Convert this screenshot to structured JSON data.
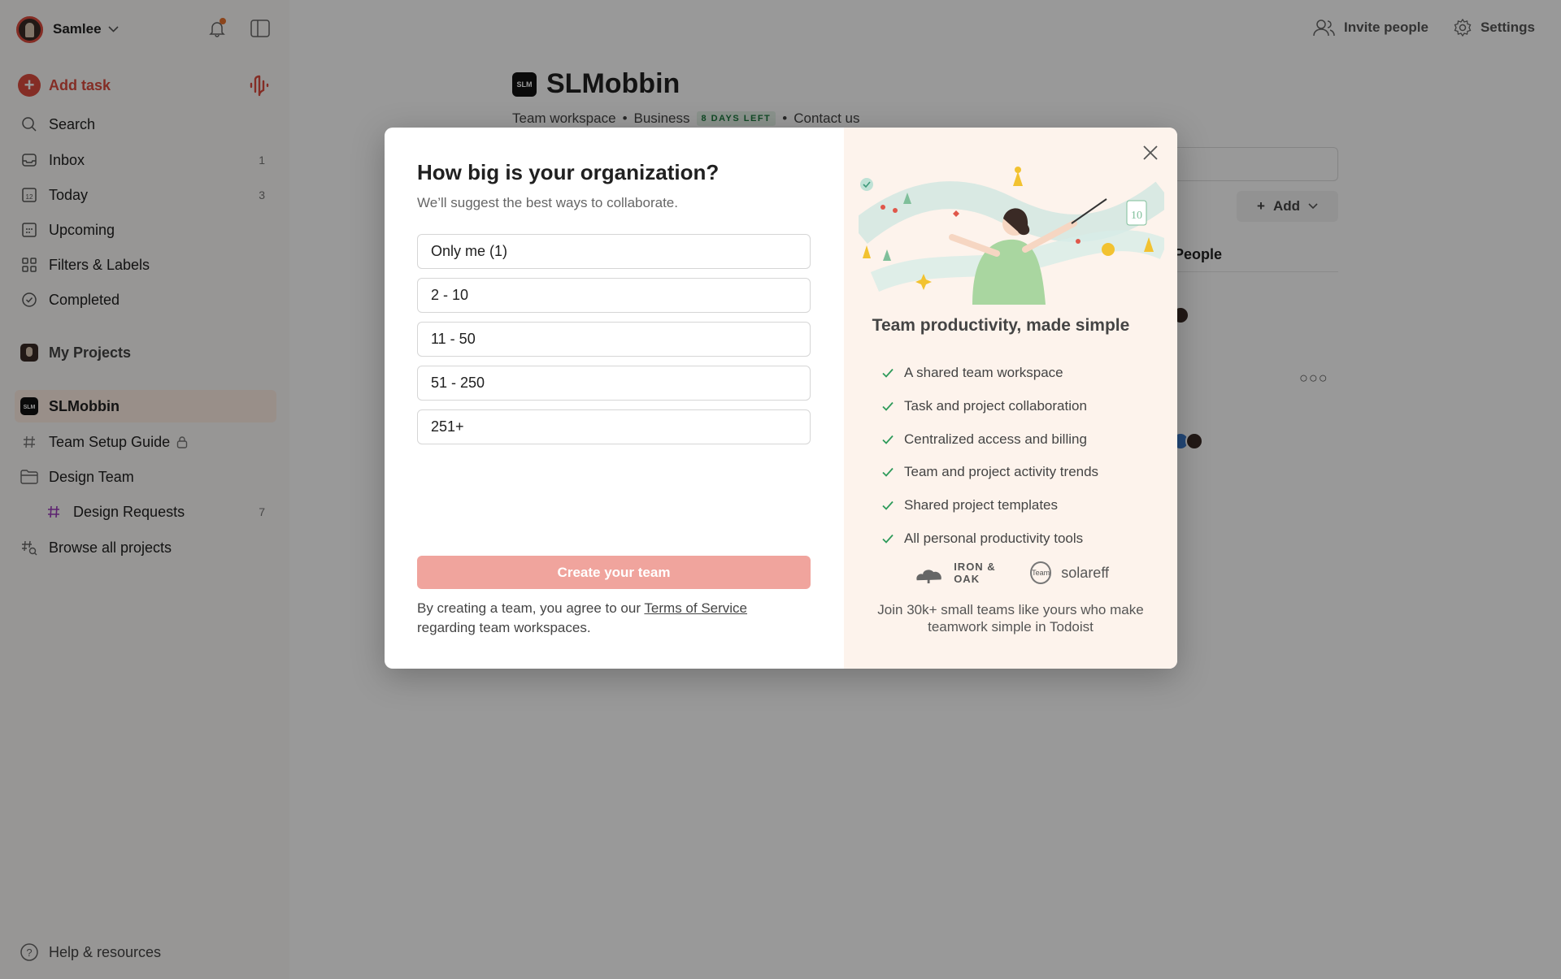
{
  "sidebar": {
    "user_name": "Samlee",
    "add_task": "Add task",
    "nav": [
      {
        "label": "Search",
        "count": ""
      },
      {
        "label": "Inbox",
        "count": "1"
      },
      {
        "label": "Today",
        "count": "3"
      },
      {
        "label": "Upcoming",
        "count": ""
      },
      {
        "label": "Filters & Labels",
        "count": ""
      },
      {
        "label": "Completed",
        "count": ""
      }
    ],
    "my_projects": "My Projects",
    "workspace": "SLMobbin",
    "projects": [
      {
        "label": "Team Setup Guide",
        "count": ""
      },
      {
        "label": "Design Team",
        "count": ""
      },
      {
        "label": "Design Requests",
        "count": "7"
      },
      {
        "label": "Browse all projects",
        "count": ""
      }
    ],
    "help": "Help & resources"
  },
  "header": {
    "invite": "Invite people",
    "settings": "Settings"
  },
  "workspace": {
    "title": "SLMobbin",
    "type": "Team workspace",
    "plan": "Business",
    "badge": "8 DAYS LEFT",
    "contact": "Contact us",
    "add_button": "Add",
    "people_header": "People"
  },
  "modal": {
    "title": "How big is your organization?",
    "subtitle": "We’ll suggest the best ways to collaborate.",
    "options": [
      "Only me (1)",
      "2 - 10",
      "11 - 50",
      "51 - 250",
      "251+"
    ],
    "create_button": "Create your team",
    "terms_prefix": "By creating a team, you agree to our",
    "terms_link": "Terms of Service",
    "terms_suffix": "regarding team workspaces.",
    "right_heading": "Team productivity, made simple",
    "features": [
      "A shared team workspace",
      "Task and project collaboration",
      "Centralized access and billing",
      "Team and project activity trends",
      "Shared project templates",
      "All personal productivity tools"
    ],
    "logos": [
      "IRON & OAK",
      "Team",
      "solareff"
    ],
    "join_text": "Join 30k+ small teams like yours who make teamwork simple in Todoist"
  },
  "colors": {
    "accent": "#dc4c3e",
    "button_disabled": "#f0a49d",
    "check": "#2d9a5a"
  }
}
